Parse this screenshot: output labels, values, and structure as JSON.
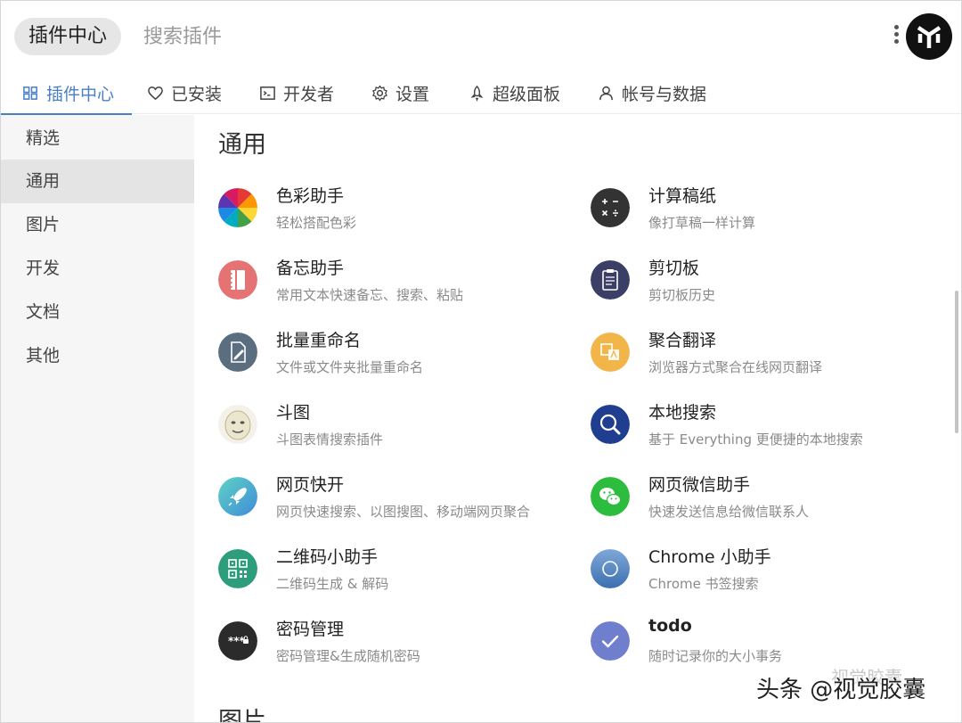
{
  "header": {
    "app_pill": "插件中心",
    "search_placeholder": "搜索插件"
  },
  "tabs": [
    {
      "label": "插件中心",
      "icon": "grid-icon",
      "active": true
    },
    {
      "label": "已安装",
      "icon": "heart-icon",
      "active": false
    },
    {
      "label": "开发者",
      "icon": "terminal-icon",
      "active": false
    },
    {
      "label": "设置",
      "icon": "gear-icon",
      "active": false
    },
    {
      "label": "超级面板",
      "icon": "rocket-icon",
      "active": false
    },
    {
      "label": "帐号与数据",
      "icon": "user-icon",
      "active": false
    }
  ],
  "sidebar": {
    "items": [
      {
        "label": "精选",
        "active": false
      },
      {
        "label": "通用",
        "active": true
      },
      {
        "label": "图片",
        "active": false
      },
      {
        "label": "开发",
        "active": false
      },
      {
        "label": "文档",
        "active": false
      },
      {
        "label": "其他",
        "active": false
      }
    ]
  },
  "main": {
    "section_title": "通用",
    "next_section_title": "图片",
    "plugins": [
      {
        "name": "色彩助手",
        "desc": "轻松搭配色彩",
        "icon": "color-wheel-icon"
      },
      {
        "name": "计算稿纸",
        "desc": "像打草稿一样计算",
        "icon": "calculator-icon"
      },
      {
        "name": "备忘助手",
        "desc": "常用文本快速备忘、搜索、粘贴",
        "icon": "notebook-icon"
      },
      {
        "name": "剪切板",
        "desc": "剪切板历史",
        "icon": "clipboard-icon"
      },
      {
        "name": "批量重命名",
        "desc": "文件或文件夹批量重命名",
        "icon": "rename-icon"
      },
      {
        "name": "聚合翻译",
        "desc": "浏览器方式聚合在线网页翻译",
        "icon": "translate-icon"
      },
      {
        "name": "斗图",
        "desc": "斗图表情搜索插件",
        "icon": "meme-face-icon"
      },
      {
        "name": "本地搜索",
        "desc": "基于 Everything 更便捷的本地搜索",
        "icon": "magnifier-icon"
      },
      {
        "name": "网页快开",
        "desc": "网页快速搜索、以图搜图、移动端网页聚合",
        "icon": "rocket-launch-icon"
      },
      {
        "name": "网页微信助手",
        "desc": "快速发送信息给微信联系人",
        "icon": "wechat-icon"
      },
      {
        "name": "二维码小助手",
        "desc": "二维码生成 & 解码",
        "icon": "qrcode-icon"
      },
      {
        "name": "Chrome 小助手",
        "desc": "Chrome 书签搜索",
        "icon": "chrome-icon"
      },
      {
        "name": "密码管理",
        "desc": "密码管理&生成随机密码",
        "icon": "password-icon"
      },
      {
        "name": "todo",
        "desc": "随时记录你的大小事务",
        "icon": "checkmark-icon"
      }
    ]
  },
  "watermark": {
    "main": "头条 @视觉胶囊",
    "faint": "视觉胶囊"
  }
}
